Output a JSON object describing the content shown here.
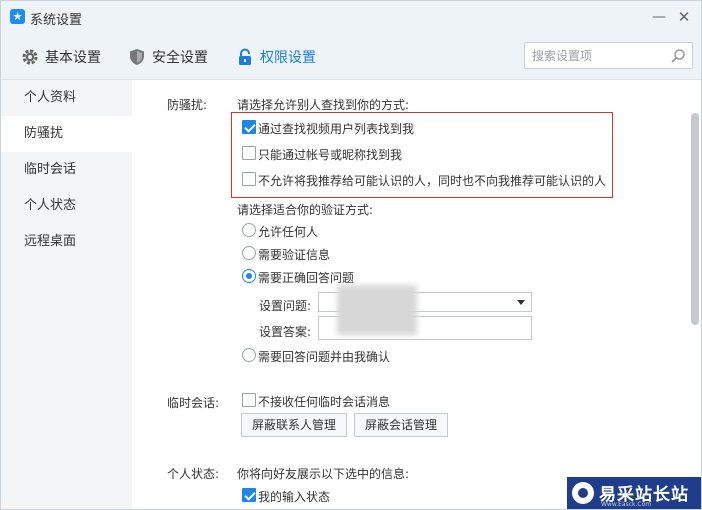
{
  "window": {
    "title": "系统设置",
    "minimize_glyph": "—",
    "close_glyph": "✕",
    "app_icon": "★"
  },
  "tabs": [
    {
      "label": "基本设置",
      "icon": "gear-icon"
    },
    {
      "label": "安全设置",
      "icon": "shield-icon"
    },
    {
      "label": "权限设置",
      "icon": "lock-icon",
      "active": true
    }
  ],
  "search": {
    "placeholder": "搜索设置项",
    "value": ""
  },
  "sidebar": {
    "items": [
      {
        "label": "个人资料"
      },
      {
        "label": "防骚扰",
        "active": true
      },
      {
        "label": "临时会话"
      },
      {
        "label": "个人状态"
      },
      {
        "label": "远程桌面"
      }
    ]
  },
  "anti_harass": {
    "section_label": "防骚扰:",
    "find_prompt": "请选择允许别人查找到你的方式:",
    "find_options": [
      {
        "label": "通过查找视频用户列表找到我",
        "checked": true
      },
      {
        "label": "只能通过帐号或昵称找到我",
        "checked": false
      },
      {
        "label": "不允许将我推荐给可能认识的人，同时也不向我推荐可能认识的人",
        "checked": false
      }
    ],
    "verify_prompt": "请选择适合你的验证方式:",
    "verify_options": [
      {
        "label": "允许任何人",
        "checked": false
      },
      {
        "label": "需要验证信息",
        "checked": false
      },
      {
        "label": "需要正确回答问题",
        "checked": true
      }
    ],
    "question_label": "设置问题:",
    "answer_label": "设置答案:",
    "last_option": {
      "label": "需要回答问题并由我确认",
      "checked": false
    }
  },
  "temp_session": {
    "section_label": "临时会话:",
    "option": {
      "label": "不接收任何临时会话消息",
      "checked": false
    },
    "buttons": [
      "屏蔽联系人管理",
      "屏蔽会话管理"
    ]
  },
  "personal_status": {
    "section_label": "个人状态:",
    "prompt": "你将向好友展示以下选中的信息:",
    "option": {
      "label": "我的输入状态",
      "checked": true
    }
  },
  "watermark": {
    "text": "易采站长站",
    "sub": "Www.Easck.Com"
  },
  "colors": {
    "accent": "#1a7fdb",
    "highlight_border": "#d9342b",
    "sidebar_bg": "#f3f5f7",
    "titlebar_bg": "#eef3f7"
  }
}
